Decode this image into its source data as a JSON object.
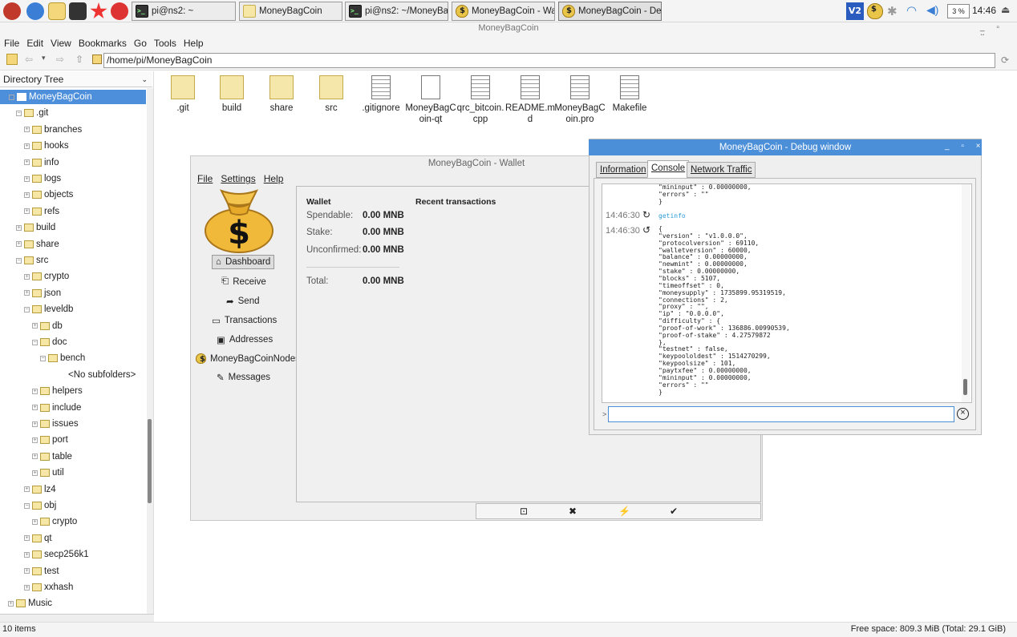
{
  "taskbar": {
    "tasks": [
      {
        "label": "pi@ns2: ~",
        "icon": "terminal-icon"
      },
      {
        "label": "MoneyBagCoin",
        "icon": "folder-icon"
      },
      {
        "label": "pi@ns2: ~/MoneyBa...",
        "icon": "terminal-icon"
      },
      {
        "label": "MoneyBagCoin - Wal...",
        "icon": "moneybag-icon"
      },
      {
        "label": "MoneyBagCoin - Deb...",
        "icon": "moneybag-icon"
      }
    ],
    "cpu": "3 %",
    "clock": "14:46"
  },
  "filemanager": {
    "title": "MoneyBagCoin",
    "menu": [
      "File",
      "Edit",
      "View",
      "Bookmarks",
      "Go",
      "Tools",
      "Help"
    ],
    "path": "/home/pi/MoneyBagCoin",
    "sidebar_header": "Directory Tree",
    "tree": [
      "MoneyBagCoin",
      ".git",
      "branches",
      "hooks",
      "info",
      "logs",
      "objects",
      "refs",
      "build",
      "share",
      "src",
      "crypto",
      "json",
      "leveldb",
      "db",
      "doc",
      "bench",
      "<No subfolders>",
      "helpers",
      "include",
      "issues",
      "port",
      "table",
      "util",
      "lz4",
      "obj",
      "crypto",
      "qt",
      "secp256k1",
      "test",
      "xxhash",
      "Music"
    ],
    "files": [
      {
        "name": ".git"
      },
      {
        "name": "build"
      },
      {
        "name": "share"
      },
      {
        "name": "src"
      },
      {
        "name": ".gitignore"
      },
      {
        "name": "MoneyBagC oin-qt"
      },
      {
        "name": "qrc_bitcoin. cpp"
      },
      {
        "name": "README.m d"
      },
      {
        "name": "MoneyBagC oin.pro"
      },
      {
        "name": "Makefile"
      }
    ],
    "status_left": "10 items",
    "status_right": "Free space: 809.3 MiB (Total: 29.1 GiB)"
  },
  "wallet": {
    "title": "MoneyBagCoin - Wallet",
    "menu": [
      "File",
      "Settings",
      "Help"
    ],
    "nav": [
      {
        "label": "Dashboard",
        "icon": "home-icon"
      },
      {
        "label": "Receive",
        "icon": "inbox-icon"
      },
      {
        "label": "Send",
        "icon": "send-icon"
      },
      {
        "label": "Transactions",
        "icon": "card-icon"
      },
      {
        "label": "Addresses",
        "icon": "address-book-icon"
      },
      {
        "label": "MoneyBagCoinNodes",
        "icon": "moneybag-icon"
      },
      {
        "label": "Messages",
        "icon": "pen-icon"
      }
    ],
    "wallet_heading": "Wallet",
    "recent_heading": "Recent transactions",
    "rows": [
      {
        "label": "Spendable:",
        "value": "0.00 MNB"
      },
      {
        "label": "Stake:",
        "value": "0.00 MNB"
      },
      {
        "label": "Unconfirmed:",
        "value": "0.00 MNB"
      },
      {
        "label": "Total:",
        "value": "0.00 MNB"
      }
    ]
  },
  "debug": {
    "title": "MoneyBagCoin - Debug window",
    "tabs": [
      "Information",
      "Console",
      "Network Traffic"
    ],
    "top_lines": [
      "\"mininput\" : 0.00000000,",
      "\"errors\" : \"\"",
      "}"
    ],
    "cmd_time": "14:46:30",
    "cmd": "getinfo",
    "reply_time": "14:46:30",
    "reply": [
      "{",
      "\"version\" : \"v1.0.0.0\",",
      "\"protocolversion\" : 69110,",
      "\"walletversion\" : 60000,",
      "\"balance\" : 0.00000000,",
      "\"newmint\" : 0.00000000,",
      "\"stake\" : 0.00000000,",
      "\"blocks\" : 5107,",
      "\"timeoffset\" : 0,",
      "\"moneysupply\" : 1735899.95319519,",
      "\"connections\" : 2,",
      "\"proxy\" : \"\",",
      "\"ip\" : \"0.0.0.0\",",
      "\"difficulty\" : {",
      "\"proof-of-work\" : 136886.00990539,",
      "\"proof-of-stake\" : 4.27579872",
      "},",
      "\"testnet\" : false,",
      "\"keypoololdest\" : 1514270299,",
      "\"keypoolsize\" : 101,",
      "\"paytxfee\" : 0.00000000,",
      "\"mininput\" : 0.00000000,",
      "\"errors\" : \"\"",
      "}"
    ],
    "prompt": ">",
    "input_value": ""
  },
  "colors": {
    "accent": "#4c8fd9",
    "selection": "#4d8fdb"
  }
}
